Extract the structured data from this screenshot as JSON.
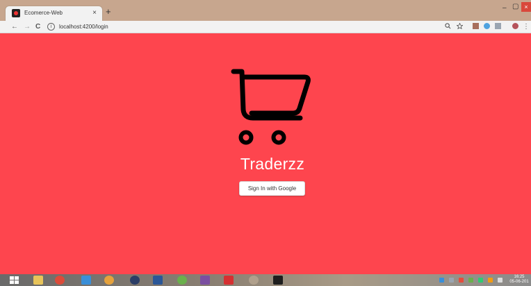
{
  "browser": {
    "tab_title": "Ecomerce-Web",
    "tab_close": "×",
    "new_tab": "+",
    "url": "localhost:4200/login",
    "info": "i",
    "window_controls": {
      "minimize": "–",
      "maximize": "▢",
      "close": "×"
    }
  },
  "nav": {
    "back": "←",
    "forward": "→",
    "reload": "C"
  },
  "page": {
    "background_color": "#fe454e",
    "brand_name": "Traderzz",
    "signin_label": "Sign In with Google",
    "logo_icon": "shopping-cart-icon"
  },
  "taskbar": {
    "time": "16:25",
    "date": "05-06-201"
  }
}
